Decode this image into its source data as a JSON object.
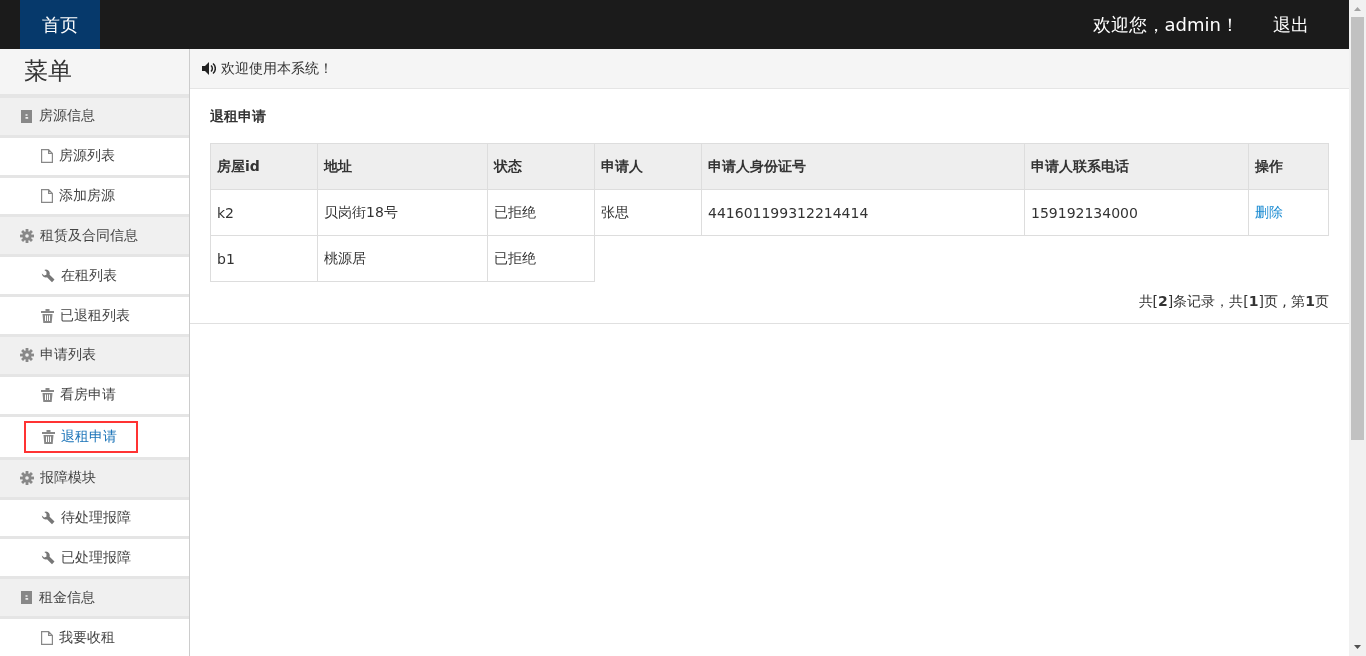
{
  "topbar": {
    "home_tab": "首页",
    "welcome": "欢迎您，admin！",
    "logout": "退出"
  },
  "sidebar": {
    "title": "菜单",
    "groups": [
      {
        "label": "房源信息",
        "items": [
          {
            "label": "房源列表",
            "selected": false
          },
          {
            "label": "添加房源",
            "selected": false
          }
        ]
      },
      {
        "label": "租赁及合同信息",
        "items": [
          {
            "label": "在租列表",
            "selected": false
          },
          {
            "label": "已退租列表",
            "selected": false
          }
        ]
      },
      {
        "label": "申请列表",
        "items": [
          {
            "label": "看房申请",
            "selected": false
          },
          {
            "label": "退租申请",
            "selected": true
          }
        ]
      },
      {
        "label": "报障模块",
        "items": [
          {
            "label": "待处理报障",
            "selected": false
          },
          {
            "label": "已处理报障",
            "selected": false
          }
        ]
      },
      {
        "label": "租金信息",
        "items": [
          {
            "label": "我要收租",
            "selected": false
          }
        ]
      }
    ]
  },
  "notice": "欢迎使用本系统！",
  "main": {
    "title": "退租申请",
    "table": {
      "columns": [
        "房屋id",
        "地址",
        "状态",
        "申请人",
        "申请人身份证号",
        "申请人联系电话",
        "操作"
      ],
      "rows": [
        [
          "k2",
          "贝岗街18号",
          "已拒绝",
          "张思",
          "441601199312214414",
          "159192134000",
          {
            "link": "删除"
          }
        ],
        [
          "b1",
          "桃源居",
          "已拒绝"
        ]
      ]
    },
    "pagination": "共[**2**]条记录，共[**1**]页 , 第**1**页"
  }
}
